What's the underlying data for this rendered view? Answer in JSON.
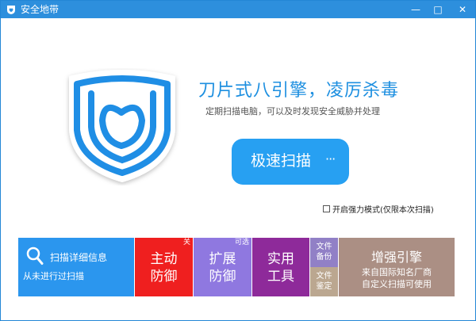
{
  "window": {
    "title": "安全地带",
    "minimize_glyph": "—",
    "maximize_glyph": "□",
    "close_glyph": "✕"
  },
  "hero": {
    "headline": "刀片式八引擎，凌厉杀毒",
    "subline": "定期扫描电脑，可以及时发现安全威胁并处理",
    "logo_icon": "shield-heart-icon"
  },
  "scan_button": {
    "label": "极速扫描",
    "more_glyph": "···"
  },
  "boost_mode": {
    "label": "开启强力模式(仅限本次扫描)",
    "checked": false
  },
  "tiles": {
    "scan_details": {
      "title": "扫描详细信息",
      "status": "从未进行过扫描",
      "icon": "search-icon"
    },
    "active_defense": {
      "line1": "主动",
      "line2": "防御",
      "tag": "关"
    },
    "extended_defense": {
      "line1": "扩展",
      "line2": "防御",
      "tag": "可选"
    },
    "tools": {
      "line1": "实用",
      "line2": "工具"
    },
    "file_backup": {
      "line1": "文件",
      "line2": "备份"
    },
    "file_verify": {
      "line1": "文件",
      "line2": "鉴定"
    },
    "engine": {
      "title": "增强引擎",
      "line1": "来自国际知名厂商",
      "line2": "自定义扫描可使用"
    }
  },
  "colors": {
    "titlebar": "#2d8fdd",
    "accent": "#27a0f2",
    "scan_tile": "#2b96ee",
    "active_defense": "#ef1f1f",
    "extended_defense": "#8f78e0",
    "tools": "#8e2a9a",
    "file_backup": "#9180c6",
    "file_verify": "#bba790",
    "engine": "#ab8f84"
  }
}
